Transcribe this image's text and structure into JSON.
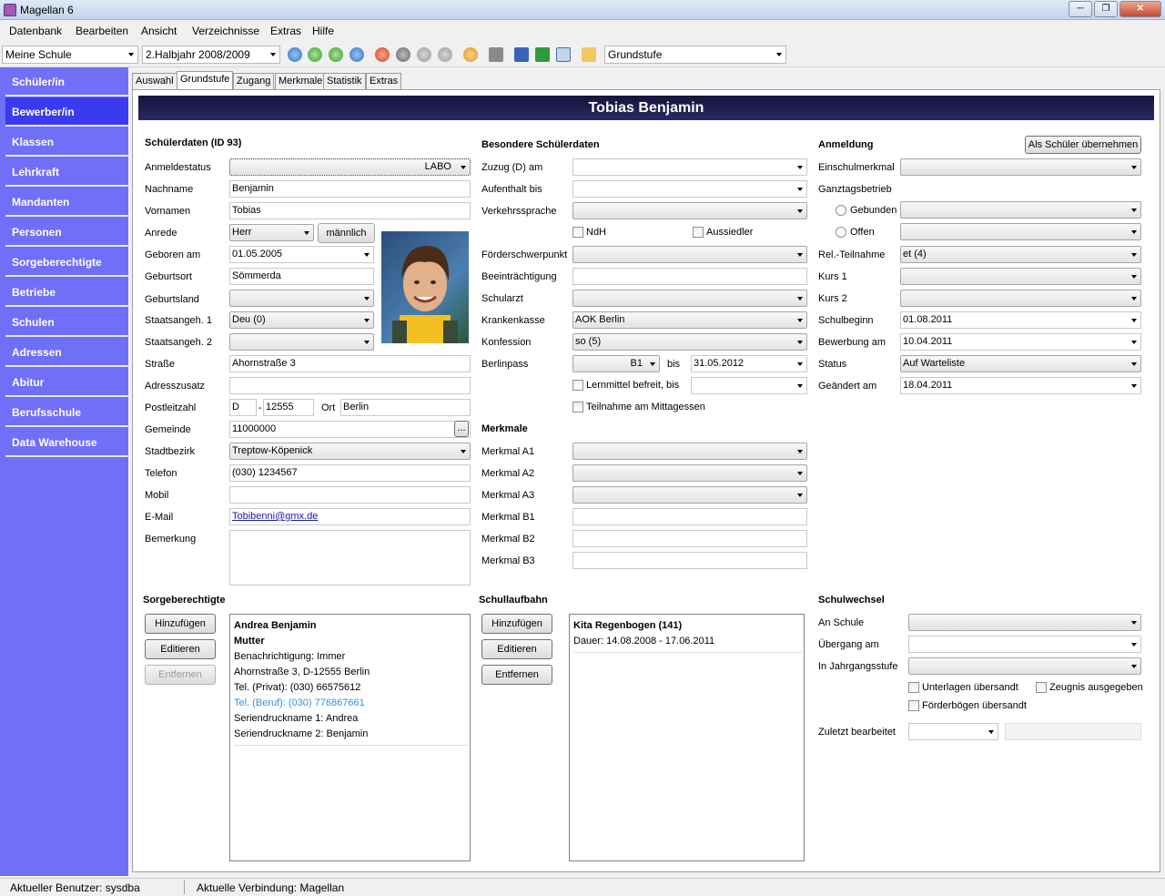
{
  "window": {
    "title": "Magellan 6"
  },
  "menu": [
    "Datenbank",
    "Bearbeiten",
    "Ansicht",
    "Verzeichnisse",
    "Extras",
    "Hilfe"
  ],
  "toolbar": {
    "school": "Meine Schule",
    "term": "2.Halbjahr 2008/2009",
    "level": "Grundstufe"
  },
  "sidebar": [
    "Schüler/in",
    "Bewerber/in",
    "Klassen",
    "Lehrkraft",
    "Mandanten",
    "Personen",
    "Sorgeberechtigte",
    "Betriebe",
    "Schulen",
    "Adressen",
    "Abitur",
    "Berufsschule",
    "Data Warehouse"
  ],
  "tabs": [
    "Auswahl",
    "Grundstufe",
    "Zugang",
    "Merkmale",
    "Statistik",
    "Extras"
  ],
  "header": {
    "name": "Tobias Benjamin"
  },
  "student": {
    "section": "Schülerdaten (ID 93)",
    "labels": [
      "Anmeldestatus",
      "Nachname",
      "Vornamen",
      "Anrede",
      "Geboren am",
      "Geburtsort",
      "Geburtsland",
      "Staatsangeh. 1",
      "Staatsangeh. 2",
      "Straße",
      "Adresszusatz",
      "Postleitzahl",
      "Gemeinde",
      "Stadtbezirk",
      "Telefon",
      "Mobil",
      "E-Mail",
      "Bemerkung"
    ],
    "anmeldestatus": "LABO",
    "nachname": "Benjamin",
    "vornamen": "Tobias",
    "anrede": "Herr",
    "geschlecht": "männlich",
    "geboren": "01.05.2005",
    "geburtsort": "Sömmerda",
    "geburtsland": "",
    "staat1": "Deu (0)",
    "staat2": "",
    "strasse": "Ahornstraße 3",
    "adresszusatz": "",
    "land": "D",
    "dash": "-",
    "plz": "12555",
    "ort_label": "Ort",
    "ort": "Berlin",
    "gemeinde": "11000000",
    "gemeinde_btn": "...",
    "stadtbezirk": "Treptow-Köpenick",
    "telefon": "(030) 1234567",
    "mobil": "",
    "email": "Tobibenni@gmx.de"
  },
  "special": {
    "section": "Besondere Schülerdaten",
    "labels": [
      "Zuzug (D) am",
      "Aufenthalt bis",
      "Verkehrssprache",
      "Förderschwerpunkt",
      "Beeinträchtigung",
      "Schularzt",
      "Krankenkasse",
      "Konfession",
      "Berlinpass"
    ],
    "ndh": "NdH",
    "aussiedler": "Aussiedler",
    "krankenkasse": "AOK Berlin",
    "konfession": "so (5)",
    "berlinpass": "B1",
    "bis": "bis",
    "bis_date": "31.05.2012",
    "lernmittel": "Lernmittel befreit, bis",
    "mittagessen": "Teilnahme am Mittagessen"
  },
  "merkmale": {
    "section": "Merkmale",
    "labels": [
      "Merkmal A1",
      "Merkmal A2",
      "Merkmal A3",
      "Merkmal B1",
      "Merkmal B2",
      "Merkmal B3"
    ]
  },
  "anmeldung": {
    "section": "Anmeldung",
    "button": "Als Schüler übernehmen",
    "labels": [
      "Einschulmerkmal",
      "Ganztagsbetrieb",
      "Rel.-Teilnahme",
      "Kurs 1",
      "Kurs 2",
      "Schulbeginn",
      "Bewerbung am",
      "Status",
      "Geändert am"
    ],
    "gebunden": "Gebunden",
    "offen": "Offen",
    "rel": "et (4)",
    "schulbeginn": "01.08.2011",
    "bewerbung": "10.04.2011",
    "status": "Auf Warteliste",
    "geaendert": "18.04.2011"
  },
  "sorge": {
    "section": "Sorgeberechtigte",
    "buttons": [
      "Hinzufügen",
      "Editieren",
      "Entfernen"
    ],
    "lines": [
      "Andrea Benjamin",
      "Mutter",
      "Benachrichtigung: Immer",
      "Ahornstraße 3, D-12555 Berlin",
      "Tel. (Privat): (030) 66575612",
      "Tel. (Beruf): (030) 776867661",
      "Seriendruckname 1: Andrea",
      "Seriendruckname 2: Benjamin"
    ]
  },
  "laufbahn": {
    "section": "Schullaufbahn",
    "buttons": [
      "Hinzufügen",
      "Editieren",
      "Entfernen"
    ],
    "lines": [
      "Kita Regenbogen (141)",
      "Dauer: 14.08.2008 - 17.06.2011"
    ]
  },
  "wechsel": {
    "section": "Schulwechsel",
    "labels": [
      "An Schule",
      "Übergang am",
      "In Jahrgangsstufe"
    ],
    "unterlagen": "Unterlagen übersandt",
    "zeugnis": "Zeugnis ausgegeben",
    "foerder": "Förderbögen übersandt",
    "zuletzt": "Zuletzt bearbeitet"
  },
  "status": {
    "user": "Aktueller Benutzer: sysdba",
    "conn": "Aktuelle Verbindung: Magellan"
  },
  "colors": {
    "sidebar": "#6f6ff8",
    "sidebar_active": "#3a3af0",
    "header": "#1a1a48",
    "link": "#1a1ab0",
    "beruf": "#3a8fd8"
  }
}
